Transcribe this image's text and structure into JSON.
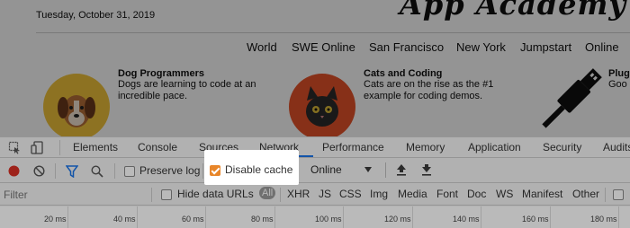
{
  "page": {
    "date": "Tuesday, October 31, 2019",
    "masthead": "App Academy",
    "nav": [
      "World",
      "SWE Online",
      "San Francisco",
      "New York",
      "Jumpstart",
      "Online"
    ],
    "stories": [
      {
        "title": "Dog Programmers",
        "text": "Dogs are learning to code at an incredible pace."
      },
      {
        "title": "Cats and Coding",
        "text": "Cats are on the rise as the #1 example for coding demos."
      },
      {
        "title": "Plug",
        "text": "Goo"
      }
    ]
  },
  "devtools": {
    "tabs": [
      "Elements",
      "Console",
      "Sources",
      "Network",
      "Performance",
      "Memory",
      "Application",
      "Security",
      "Audits"
    ],
    "active_tab": "Network",
    "toolbar": {
      "preserve_log": "Preserve log",
      "disable_cache": "Disable cache",
      "throttle": "Online"
    },
    "filter": {
      "placeholder": "Filter",
      "hide_data_urls": "Hide data URLs",
      "types": [
        "All",
        "XHR",
        "JS",
        "CSS",
        "Img",
        "Media",
        "Font",
        "Doc",
        "WS",
        "Manifest",
        "Other"
      ]
    },
    "timeline_ticks": [
      "20 ms",
      "40 ms",
      "60 ms",
      "80 ms",
      "100 ms",
      "120 ms",
      "140 ms",
      "160 ms",
      "180 ms"
    ],
    "colors": {
      "accent": "#1a73e8",
      "record": "#d93025",
      "checkbox_on": "#e8862a"
    }
  }
}
